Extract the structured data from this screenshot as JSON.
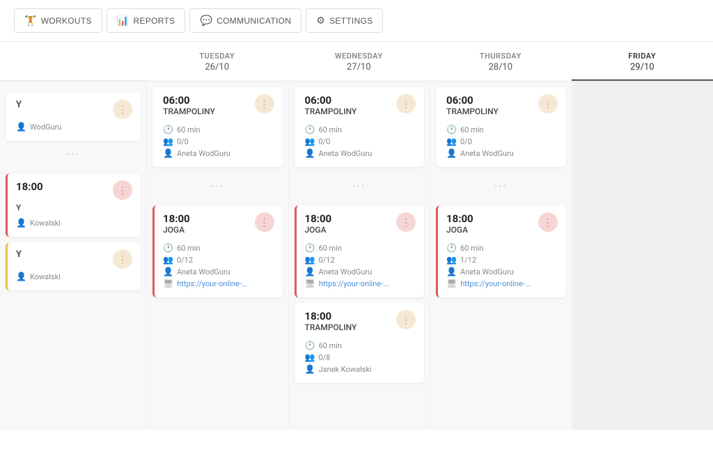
{
  "nav": {
    "tabs": [
      {
        "id": "workouts",
        "label": "WORKOUTS",
        "icon": "🏋"
      },
      {
        "id": "reports",
        "label": "REPORTS",
        "icon": "📊"
      },
      {
        "id": "communication",
        "label": "COMMUNICATION",
        "icon": "💬"
      },
      {
        "id": "settings",
        "label": "SETTINGS",
        "icon": "⚙"
      }
    ]
  },
  "calendar": {
    "days": [
      {
        "name": "TUESDAY",
        "date": "26/10",
        "active": false
      },
      {
        "name": "WEDNESDAY",
        "date": "27/10",
        "active": false
      },
      {
        "name": "THURSDAY",
        "date": "28/10",
        "active": false
      },
      {
        "name": "FRIDAY",
        "date": "29/10",
        "active": true
      }
    ],
    "tuesday_partial": {
      "card1": {
        "name_partial": "Y",
        "trainer": "WodGuru"
      },
      "card2_time": "18:00",
      "card2_name_partial": "Y",
      "card2_trainer_partial": "Kowalski"
    },
    "wednesday": {
      "card1": {
        "time": "06:00",
        "name": "TRAMPOLINY",
        "duration": "60 min",
        "spots": "0/0",
        "trainer": "Aneta WodGuru"
      },
      "card2": {
        "time": "18:00",
        "name": "JOGA",
        "duration": "60 min",
        "spots": "0/12",
        "trainer": "Aneta WodGuru",
        "link": "https://your-online-..."
      }
    },
    "thursday": {
      "card1": {
        "time": "06:00",
        "name": "TRAMPOLINY",
        "duration": "60 min",
        "spots": "0/0",
        "trainer": "Aneta WodGuru"
      },
      "card2": {
        "time": "18:00",
        "name": "JOGA",
        "duration": "60 min",
        "spots": "0/12",
        "trainer": "Aneta WodGuru",
        "link": "https://your-online-..."
      },
      "card3": {
        "time": "18:00",
        "name": "TRAMPOLINY",
        "duration": "60 min",
        "spots": "0/8",
        "trainer": "Janek Kowalski"
      }
    },
    "friday": {
      "card1": {
        "time": "06:00",
        "name": "TRAMPOLINY",
        "duration": "60 min",
        "spots": "0/0",
        "trainer": "Aneta WodGuru"
      },
      "card2": {
        "time": "18:00",
        "name": "JOGA",
        "duration": "60 min",
        "spots": "1/12",
        "trainer": "Aneta WodGuru",
        "link": "https://your-online-..."
      }
    },
    "dots": "···",
    "more_dots": "···"
  }
}
